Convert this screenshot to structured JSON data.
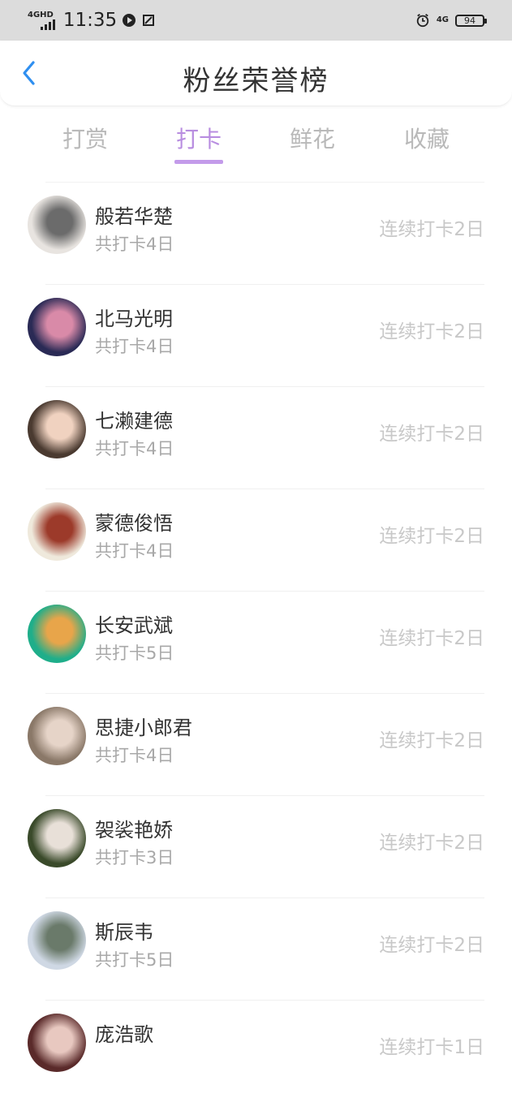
{
  "status_bar": {
    "network": "4GHD",
    "time": "11:35",
    "right_network": "4G",
    "battery": "94"
  },
  "header": {
    "title": "粉丝荣誉榜",
    "back_icon": "chevron-left-icon",
    "accent": "#2f8ff0"
  },
  "tabs": [
    {
      "label": "打赏",
      "active": false
    },
    {
      "label": "打卡",
      "active": true
    },
    {
      "label": "鲜花",
      "active": false
    },
    {
      "label": "收藏",
      "active": false
    }
  ],
  "active_color": "#c39bea",
  "fans": [
    {
      "name": "般若华楚",
      "total": "共打卡4日",
      "streak": "连续打卡2日",
      "avatar_colors": [
        "#e8e4e0",
        "#6b6b6b"
      ]
    },
    {
      "name": "北马光明",
      "total": "共打卡4日",
      "streak": "连续打卡2日",
      "avatar_colors": [
        "#2a2a55",
        "#d98aa8"
      ]
    },
    {
      "name": "七濑建德",
      "total": "共打卡4日",
      "streak": "连续打卡2日",
      "avatar_colors": [
        "#4a3a30",
        "#f0d2c0"
      ]
    },
    {
      "name": "蒙德俊悟",
      "total": "共打卡4日",
      "streak": "连续打卡2日",
      "avatar_colors": [
        "#efe9dc",
        "#9c3a2a"
      ]
    },
    {
      "name": "长安武斌",
      "total": "共打卡5日",
      "streak": "连续打卡2日",
      "avatar_colors": [
        "#1fae8a",
        "#e8a54a"
      ]
    },
    {
      "name": "思捷小郎君",
      "total": "共打卡4日",
      "streak": "连续打卡2日",
      "avatar_colors": [
        "#8a7868",
        "#e6d4c8"
      ]
    },
    {
      "name": "袈裟艳娇",
      "total": "共打卡3日",
      "streak": "连续打卡2日",
      "avatar_colors": [
        "#3a4a2a",
        "#e8e0d8"
      ]
    },
    {
      "name": "斯辰韦",
      "total": "共打卡5日",
      "streak": "连续打卡2日",
      "avatar_colors": [
        "#cfd8e4",
        "#6a7a6a"
      ]
    },
    {
      "name": "庞浩歌",
      "total": "",
      "streak": "连续打卡1日",
      "avatar_colors": [
        "#5a2a2a",
        "#e8c8c0"
      ]
    }
  ]
}
